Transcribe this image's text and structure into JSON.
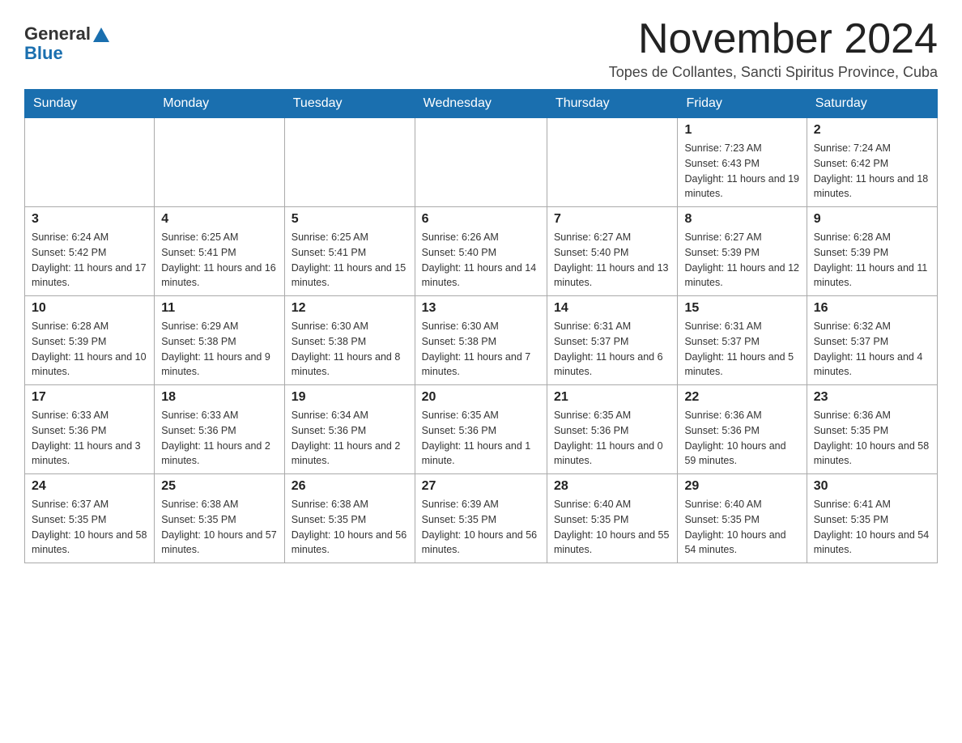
{
  "header": {
    "logo_general": "General",
    "logo_blue": "Blue",
    "title": "November 2024",
    "subtitle": "Topes de Collantes, Sancti Spiritus Province, Cuba"
  },
  "days_of_week": [
    "Sunday",
    "Monday",
    "Tuesday",
    "Wednesday",
    "Thursday",
    "Friday",
    "Saturday"
  ],
  "weeks": [
    [
      {
        "day": "",
        "sunrise": "",
        "sunset": "",
        "daylight": ""
      },
      {
        "day": "",
        "sunrise": "",
        "sunset": "",
        "daylight": ""
      },
      {
        "day": "",
        "sunrise": "",
        "sunset": "",
        "daylight": ""
      },
      {
        "day": "",
        "sunrise": "",
        "sunset": "",
        "daylight": ""
      },
      {
        "day": "",
        "sunrise": "",
        "sunset": "",
        "daylight": ""
      },
      {
        "day": "1",
        "sunrise": "Sunrise: 7:23 AM",
        "sunset": "Sunset: 6:43 PM",
        "daylight": "Daylight: 11 hours and 19 minutes."
      },
      {
        "day": "2",
        "sunrise": "Sunrise: 7:24 AM",
        "sunset": "Sunset: 6:42 PM",
        "daylight": "Daylight: 11 hours and 18 minutes."
      }
    ],
    [
      {
        "day": "3",
        "sunrise": "Sunrise: 6:24 AM",
        "sunset": "Sunset: 5:42 PM",
        "daylight": "Daylight: 11 hours and 17 minutes."
      },
      {
        "day": "4",
        "sunrise": "Sunrise: 6:25 AM",
        "sunset": "Sunset: 5:41 PM",
        "daylight": "Daylight: 11 hours and 16 minutes."
      },
      {
        "day": "5",
        "sunrise": "Sunrise: 6:25 AM",
        "sunset": "Sunset: 5:41 PM",
        "daylight": "Daylight: 11 hours and 15 minutes."
      },
      {
        "day": "6",
        "sunrise": "Sunrise: 6:26 AM",
        "sunset": "Sunset: 5:40 PM",
        "daylight": "Daylight: 11 hours and 14 minutes."
      },
      {
        "day": "7",
        "sunrise": "Sunrise: 6:27 AM",
        "sunset": "Sunset: 5:40 PM",
        "daylight": "Daylight: 11 hours and 13 minutes."
      },
      {
        "day": "8",
        "sunrise": "Sunrise: 6:27 AM",
        "sunset": "Sunset: 5:39 PM",
        "daylight": "Daylight: 11 hours and 12 minutes."
      },
      {
        "day": "9",
        "sunrise": "Sunrise: 6:28 AM",
        "sunset": "Sunset: 5:39 PM",
        "daylight": "Daylight: 11 hours and 11 minutes."
      }
    ],
    [
      {
        "day": "10",
        "sunrise": "Sunrise: 6:28 AM",
        "sunset": "Sunset: 5:39 PM",
        "daylight": "Daylight: 11 hours and 10 minutes."
      },
      {
        "day": "11",
        "sunrise": "Sunrise: 6:29 AM",
        "sunset": "Sunset: 5:38 PM",
        "daylight": "Daylight: 11 hours and 9 minutes."
      },
      {
        "day": "12",
        "sunrise": "Sunrise: 6:30 AM",
        "sunset": "Sunset: 5:38 PM",
        "daylight": "Daylight: 11 hours and 8 minutes."
      },
      {
        "day": "13",
        "sunrise": "Sunrise: 6:30 AM",
        "sunset": "Sunset: 5:38 PM",
        "daylight": "Daylight: 11 hours and 7 minutes."
      },
      {
        "day": "14",
        "sunrise": "Sunrise: 6:31 AM",
        "sunset": "Sunset: 5:37 PM",
        "daylight": "Daylight: 11 hours and 6 minutes."
      },
      {
        "day": "15",
        "sunrise": "Sunrise: 6:31 AM",
        "sunset": "Sunset: 5:37 PM",
        "daylight": "Daylight: 11 hours and 5 minutes."
      },
      {
        "day": "16",
        "sunrise": "Sunrise: 6:32 AM",
        "sunset": "Sunset: 5:37 PM",
        "daylight": "Daylight: 11 hours and 4 minutes."
      }
    ],
    [
      {
        "day": "17",
        "sunrise": "Sunrise: 6:33 AM",
        "sunset": "Sunset: 5:36 PM",
        "daylight": "Daylight: 11 hours and 3 minutes."
      },
      {
        "day": "18",
        "sunrise": "Sunrise: 6:33 AM",
        "sunset": "Sunset: 5:36 PM",
        "daylight": "Daylight: 11 hours and 2 minutes."
      },
      {
        "day": "19",
        "sunrise": "Sunrise: 6:34 AM",
        "sunset": "Sunset: 5:36 PM",
        "daylight": "Daylight: 11 hours and 2 minutes."
      },
      {
        "day": "20",
        "sunrise": "Sunrise: 6:35 AM",
        "sunset": "Sunset: 5:36 PM",
        "daylight": "Daylight: 11 hours and 1 minute."
      },
      {
        "day": "21",
        "sunrise": "Sunrise: 6:35 AM",
        "sunset": "Sunset: 5:36 PM",
        "daylight": "Daylight: 11 hours and 0 minutes."
      },
      {
        "day": "22",
        "sunrise": "Sunrise: 6:36 AM",
        "sunset": "Sunset: 5:36 PM",
        "daylight": "Daylight: 10 hours and 59 minutes."
      },
      {
        "day": "23",
        "sunrise": "Sunrise: 6:36 AM",
        "sunset": "Sunset: 5:35 PM",
        "daylight": "Daylight: 10 hours and 58 minutes."
      }
    ],
    [
      {
        "day": "24",
        "sunrise": "Sunrise: 6:37 AM",
        "sunset": "Sunset: 5:35 PM",
        "daylight": "Daylight: 10 hours and 58 minutes."
      },
      {
        "day": "25",
        "sunrise": "Sunrise: 6:38 AM",
        "sunset": "Sunset: 5:35 PM",
        "daylight": "Daylight: 10 hours and 57 minutes."
      },
      {
        "day": "26",
        "sunrise": "Sunrise: 6:38 AM",
        "sunset": "Sunset: 5:35 PM",
        "daylight": "Daylight: 10 hours and 56 minutes."
      },
      {
        "day": "27",
        "sunrise": "Sunrise: 6:39 AM",
        "sunset": "Sunset: 5:35 PM",
        "daylight": "Daylight: 10 hours and 56 minutes."
      },
      {
        "day": "28",
        "sunrise": "Sunrise: 6:40 AM",
        "sunset": "Sunset: 5:35 PM",
        "daylight": "Daylight: 10 hours and 55 minutes."
      },
      {
        "day": "29",
        "sunrise": "Sunrise: 6:40 AM",
        "sunset": "Sunset: 5:35 PM",
        "daylight": "Daylight: 10 hours and 54 minutes."
      },
      {
        "day": "30",
        "sunrise": "Sunrise: 6:41 AM",
        "sunset": "Sunset: 5:35 PM",
        "daylight": "Daylight: 10 hours and 54 minutes."
      }
    ]
  ]
}
